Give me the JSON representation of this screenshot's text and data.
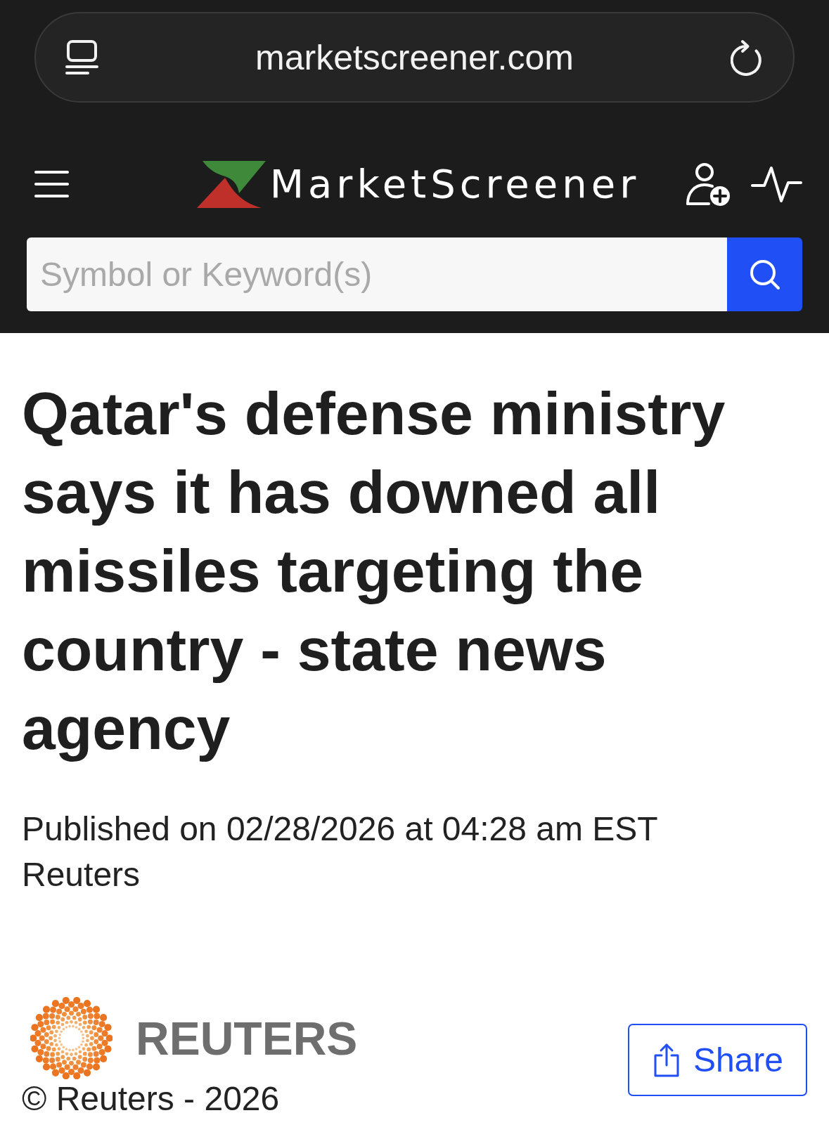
{
  "browser_bar": {
    "url": "marketscreener.com"
  },
  "header": {
    "logo": {
      "text": "MarketScreener"
    },
    "search": {
      "placeholder": "Symbol or Keyword(s)"
    }
  },
  "article": {
    "headline": "Qatar's defense ministry says it has downed all missiles targeting the country - state news agency",
    "published": "Published on 02/28/2026 at 04:28 am EST",
    "source": "Reuters"
  },
  "footer": {
    "source_logo": {
      "text": "REUTERS"
    },
    "copyright": "© Reuters - 2026",
    "share_button": {
      "label": "Share"
    }
  }
}
